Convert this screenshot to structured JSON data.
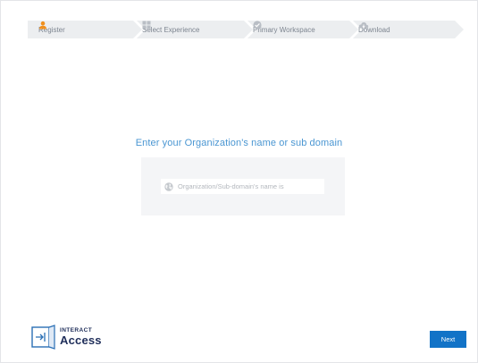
{
  "wizard": {
    "steps": [
      {
        "label": "Register",
        "icon": "user-icon",
        "active": true
      },
      {
        "label": "Select Experience",
        "icon": "grid-icon",
        "active": false
      },
      {
        "label": "Primary Workspace",
        "icon": "check-circle-icon",
        "active": false
      },
      {
        "label": "Download",
        "icon": "cloud-download-icon",
        "active": false
      }
    ]
  },
  "main": {
    "title": "Enter your Organization's name or sub domain",
    "input_placeholder": "Organization/Sub-domain's name is",
    "input_value": ""
  },
  "footer": {
    "logo_line1": "INTERACT",
    "logo_line2": "Access",
    "next_label": "Next"
  },
  "colors": {
    "accent": "#1273c7",
    "title": "#4a96d2",
    "register_icon": "#f0901e",
    "step_bg": "#eef0f2",
    "logo": "#1f2e5a"
  }
}
